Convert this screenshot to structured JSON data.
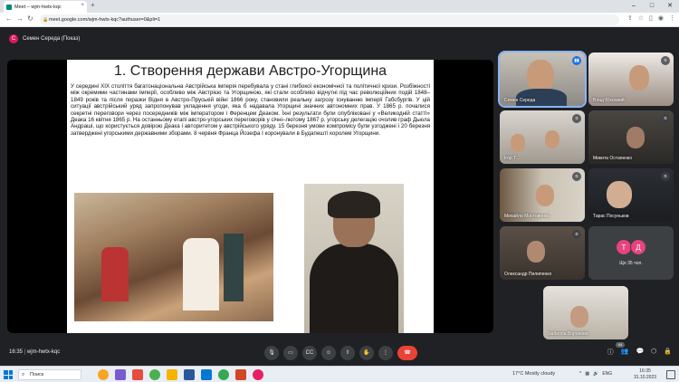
{
  "browser": {
    "tab_title": "Meet – wjm-hwtx-kqc",
    "url": "meet.google.com/wjm-hwtx-kqc?authuser=0&pli=1",
    "new_tab": "+",
    "close_tab": "×"
  },
  "presenter": {
    "initial": "С",
    "label": "Семен Середа (Показ)"
  },
  "slide": {
    "title": "1. Створення держави Австро-Угорщина",
    "body": "У середині XIX століття багатонаціональна Австрійська імперія перебувала у стані глибокої економічної та політичної кризи. Розбіжності між окремими частинами імперії, особливо між Австрією та Угорщиною, які стали особливо відчутні під час революційних подій 1848–1849 років та після поразки Відня в Австро-Пруській війні 1866 року, становили реальну загрозу існуванню імперії Габсбургів. У цій ситуації австрійський уряд запропонував укладення угоди, яка б надавала Угорщині значних автономних прав. У 1865 р. почалися секретні переговори через посередників між імператором і Ференцем Деаком. Їхні результати були опубліковані у «Великодній статті» Деака 16 квітня 1865 р. На останньому етапі австро-угорських переговорів у січні–лютому 1867 р. угорську делегацію очолив граф Дьюла Андраші, що користується довірою Деака і авторитетом у австрійського уряду. 15 березня умови компромісу були узгоджені і 20 березня затверджені угорськими державними зборами. 8 червня Франца Йозефа І коронували в Будапешті королем Угорщини."
  },
  "participants": [
    {
      "name": "Семен Середа",
      "speaking": true
    },
    {
      "name": "Влад Юхновий",
      "speaking": false
    },
    {
      "name": "Ігор Т...",
      "speaking": false
    },
    {
      "name": "Микита Остапенко",
      "speaking": false
    },
    {
      "name": "Михайло Мостовенко",
      "speaking": false
    },
    {
      "name": "Тарас Посуньков",
      "speaking": false
    },
    {
      "name": "Олександр Пилипенко",
      "speaking": false
    },
    {
      "name": "Ізабелла Воронова",
      "speaking": false
    }
  ],
  "more_tile": {
    "initials": [
      "Т",
      "Д"
    ],
    "label": "Ще 35 чол."
  },
  "meeting": {
    "time": "16:35",
    "code": "wjm-hwtx-kqc",
    "people_count": "44"
  },
  "taskbar": {
    "search": "Поиск",
    "weather": "17°C  Mostly cloudy",
    "lang": "ENG",
    "time": "16:35",
    "date": "31.10.2023"
  },
  "colors": {
    "meet_bg": "#202124",
    "leave_red": "#ea4335",
    "accent_blue": "#1a73e8"
  }
}
